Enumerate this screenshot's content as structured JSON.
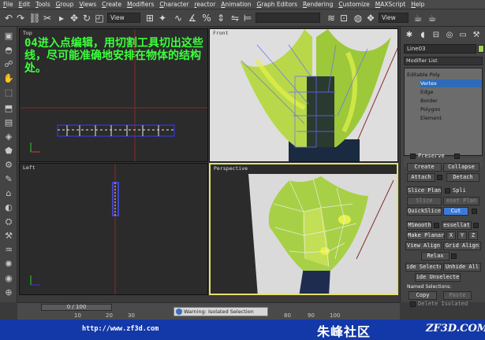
{
  "menu": [
    "File",
    "Edit",
    "Tools",
    "Group",
    "Views",
    "Create",
    "Modifiers",
    "Character",
    "reactor",
    "Animation",
    "Graph Editors",
    "Rendering",
    "Customize",
    "MAXScript",
    "Help"
  ],
  "toolbar": {
    "view_dropdown": "View",
    "view_dropdown_2": "View"
  },
  "viewports": {
    "top": "Top",
    "front": "Front",
    "left": "Left",
    "perspective": "Perspective"
  },
  "annotation": {
    "text": "04进入点编辑，用切割工具切出这些线，尽可能准确地安排在物体的结构处。"
  },
  "command_panel": {
    "object_name": "Line03",
    "modifier_list": "Modifier List",
    "stack": {
      "base": "Editable Poly",
      "subobjects": [
        "Vertex",
        "Edge",
        "Border",
        "Polygon",
        "Element"
      ],
      "selected": "Vertex"
    },
    "buttons": {
      "preserve": "Preserve",
      "create": "Create",
      "collapse": "Collapse",
      "attach": "Attach",
      "detach": "Detach",
      "slice_plane": "Slice Plane",
      "split": "Spli",
      "slice": "Slice",
      "reset_plane": "eset Plan",
      "quickslice": "QuickSlice",
      "cut": "Cut",
      "msmooth": "MSmooth",
      "tessellate": "essellat",
      "make_planar": "Make Planar",
      "x": "X",
      "y": "Y",
      "z": "Z",
      "view_align": "View Align",
      "grid_align": "Grid Align",
      "relax": "Relax",
      "hide_selected": "ide Selecte",
      "unhide_all": "Unhide All",
      "hide_unselected": "ide Unselecte",
      "copy": "Copy",
      "paste": "Paste",
      "delete_isolated": "Delete Isolated"
    },
    "named_selections_label": "Named Selections:"
  },
  "timeline": {
    "slider": "0 / 100",
    "ticks": [
      "10",
      "20",
      "30",
      "80",
      "90",
      "100"
    ]
  },
  "warning": "Warning: Isolated Selection",
  "footer": {
    "url": "http://www.zf3d.com",
    "brand_cn": "朱峰社区",
    "brand_en": "ZF3D.COM"
  },
  "colors": {
    "annotation": "#3cff3c",
    "active_viewport": "#e6e06a",
    "selection": "#2d6bb8",
    "footer_bg": "#1338a8",
    "swatch": "#9fd15a"
  }
}
